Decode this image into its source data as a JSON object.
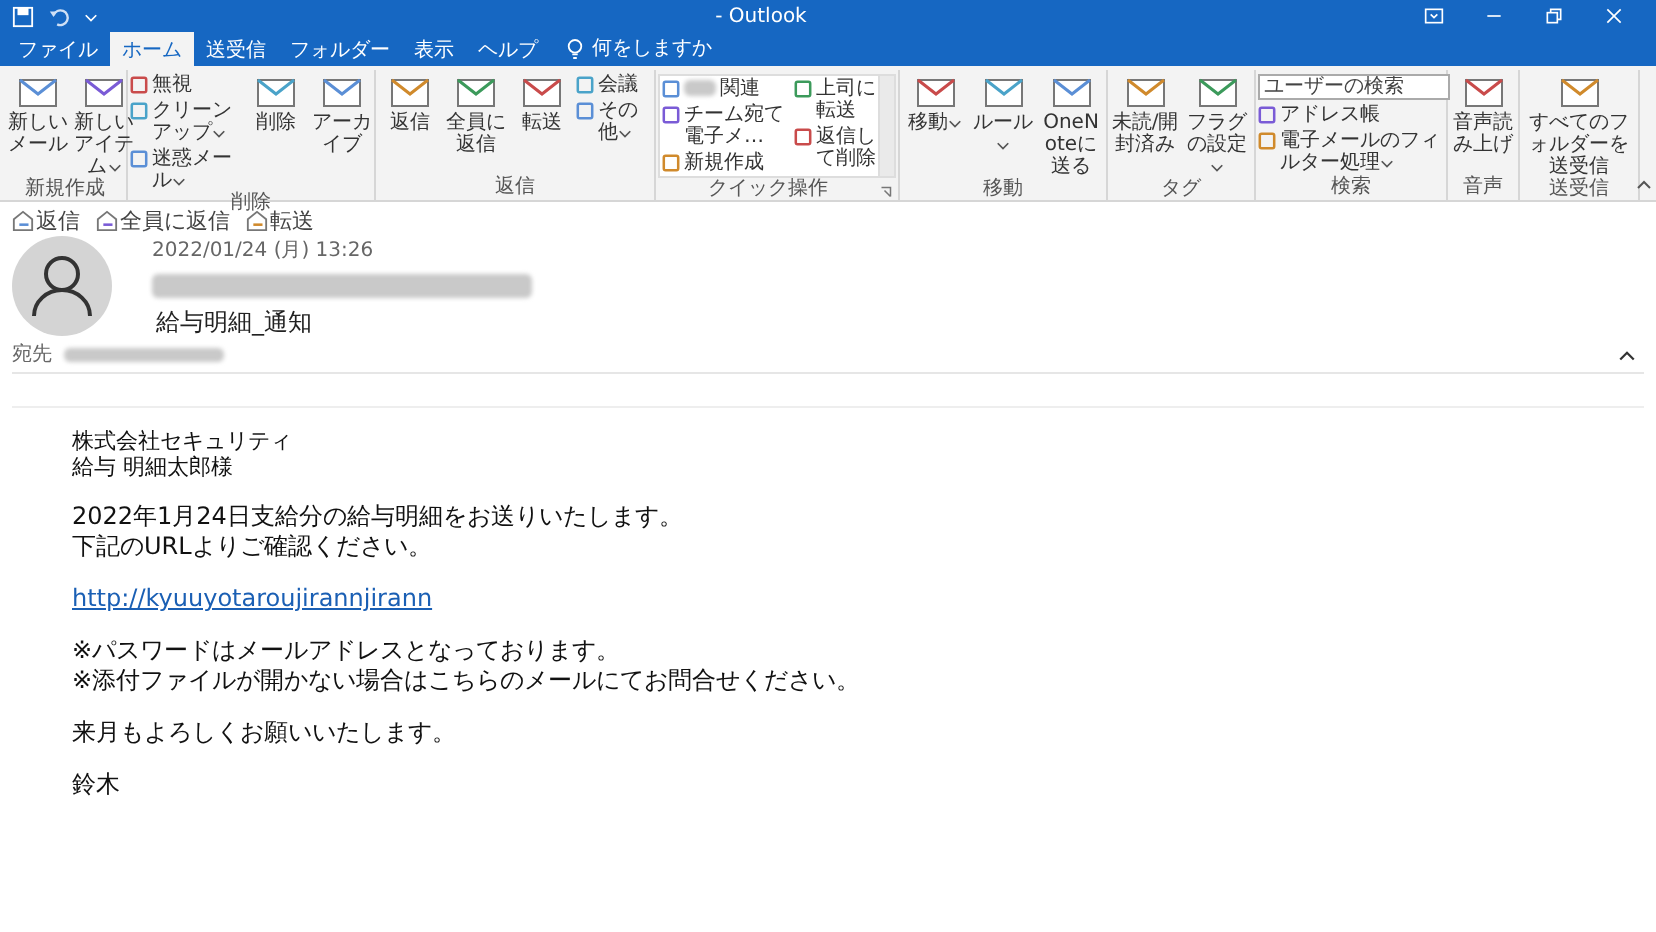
{
  "window": {
    "title": "- Outlook"
  },
  "tabs": [
    {
      "label": "ファイル",
      "selected": false
    },
    {
      "label": "ホーム",
      "selected": true
    },
    {
      "label": "送受信",
      "selected": false
    },
    {
      "label": "フォルダー",
      "selected": false
    },
    {
      "label": "表示",
      "selected": false
    },
    {
      "label": "ヘルプ",
      "selected": false
    }
  ],
  "tell_me": {
    "placeholder": "何をしますか"
  },
  "ribbon": {
    "groups": [
      {
        "label": "新規作成",
        "launcher": false,
        "items": [
          {
            "kind": "large",
            "label": "新しいメール",
            "dropdown": false
          },
          {
            "kind": "large",
            "label": "新しいアイテム",
            "dropdown": true
          }
        ]
      },
      {
        "label": "削除",
        "launcher": false,
        "items": [
          {
            "kind": "small",
            "label": "無視",
            "dropdown": false
          },
          {
            "kind": "small",
            "label": "クリーンアップ",
            "dropdown": true
          },
          {
            "kind": "small",
            "label": "迷惑メール",
            "dropdown": true
          },
          {
            "kind": "large",
            "label": "削除",
            "dropdown": false
          },
          {
            "kind": "large",
            "label": "アーカイブ",
            "dropdown": false
          }
        ]
      },
      {
        "label": "返信",
        "launcher": false,
        "items": [
          {
            "kind": "large",
            "label": "返信",
            "dropdown": false
          },
          {
            "kind": "large",
            "label": "全員に返信",
            "dropdown": false
          },
          {
            "kind": "large",
            "label": "転送",
            "dropdown": false
          },
          {
            "kind": "small",
            "label": "会議",
            "dropdown": false
          },
          {
            "kind": "small",
            "label": "その他",
            "dropdown": true
          }
        ]
      },
      {
        "label": "クイック操作",
        "launcher": true,
        "items": [
          {
            "kind": "gallery",
            "columns": [
              [
                {
                  "label": "関連",
                  "redacted": true
                },
                {
                  "label": "チーム宛て電子メ…",
                  "redacted": false
                },
                {
                  "label": "新規作成",
                  "redacted": false
                }
              ],
              [
                {
                  "label": "上司に転送",
                  "redacted": false
                },
                {
                  "label": "返信して削除",
                  "redacted": false
                }
              ]
            ]
          }
        ]
      },
      {
        "label": "移動",
        "launcher": false,
        "items": [
          {
            "kind": "large",
            "label": "移動",
            "dropdown": true
          },
          {
            "kind": "large",
            "label": "ルール",
            "dropdown": true
          },
          {
            "kind": "large",
            "label": "OneNoteに送る",
            "dropdown": false
          }
        ]
      },
      {
        "label": "タグ",
        "launcher": false,
        "items": [
          {
            "kind": "large",
            "label": "未読/開封済み",
            "dropdown": false
          },
          {
            "kind": "large",
            "label": "フラグの設定",
            "dropdown": true
          }
        ]
      },
      {
        "label": "検索",
        "launcher": false,
        "items": [
          {
            "kind": "search",
            "placeholder": "ユーザーの検索"
          },
          {
            "kind": "small",
            "label": "アドレス帳",
            "dropdown": false
          },
          {
            "kind": "small",
            "label": "電子メールのフィルター処理",
            "dropdown": true
          }
        ]
      },
      {
        "label": "音声",
        "launcher": false,
        "items": [
          {
            "kind": "large",
            "label": "音声読み上げ",
            "dropdown": false
          }
        ]
      },
      {
        "label": "送受信",
        "launcher": false,
        "items": [
          {
            "kind": "large",
            "label": "すべてのフォルダーを送受信",
            "dropdown": false
          }
        ]
      }
    ]
  },
  "message": {
    "actions": [
      {
        "label": "返信"
      },
      {
        "label": "全員に返信"
      },
      {
        "label": "転送"
      }
    ],
    "date": "2022/01/24 (月) 13:26",
    "subject": "給与明細_通知",
    "to_label": "宛先",
    "body": [
      {
        "kind": "text",
        "lines": [
          "株式会社セキュリティ",
          "給与 明細太郎様"
        ]
      },
      {
        "kind": "text",
        "lines": [
          "2022年1月24日支給分の給与明細をお送りいたします。",
          "下記のURLよりご確認ください。"
        ]
      },
      {
        "kind": "link",
        "lines": [
          "http://kyuuyotaroujirannjirann"
        ]
      },
      {
        "kind": "text",
        "lines": [
          "※パスワードはメールアドレスとなっております。",
          "※添付ファイルが開かない場合はこちらのメールにてお問合せください。"
        ]
      },
      {
        "kind": "text",
        "lines": [
          "来月もよろしくお願いいたします。"
        ]
      },
      {
        "kind": "text",
        "lines": [
          "鈴木"
        ]
      }
    ]
  }
}
